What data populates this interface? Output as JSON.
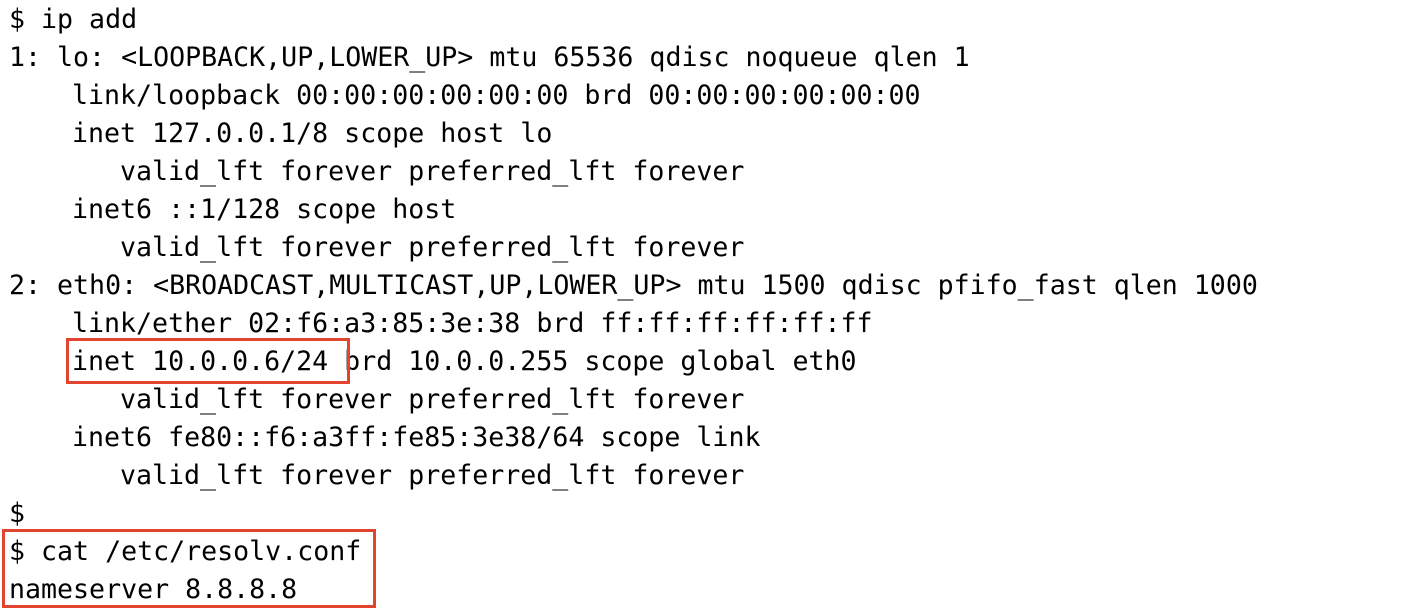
{
  "colors": {
    "background": "#ffffff",
    "text": "#000000",
    "highlight_border": "#e2442f"
  },
  "terminal": {
    "lines": [
      {
        "text": "$ ip add",
        "indent": 0
      },
      {
        "text": "1: lo: <LOOPBACK,UP,LOWER_UP> mtu 65536 qdisc noqueue qlen 1",
        "indent": 0
      },
      {
        "text": "link/loopback 00:00:00:00:00:00 brd 00:00:00:00:00:00",
        "indent": 1
      },
      {
        "text": "inet 127.0.0.1/8 scope host lo",
        "indent": 1
      },
      {
        "text": "valid_lft forever preferred_lft forever",
        "indent": 2
      },
      {
        "text": "inet6 ::1/128 scope host",
        "indent": 1
      },
      {
        "text": "valid_lft forever preferred_lft forever",
        "indent": 2
      },
      {
        "text": "2: eth0: <BROADCAST,MULTICAST,UP,LOWER_UP> mtu 1500 qdisc pfifo_fast qlen 1000",
        "indent": 0
      },
      {
        "text": "link/ether 02:f6:a3:85:3e:38 brd ff:ff:ff:ff:ff:ff",
        "indent": 1
      },
      {
        "text": "inet 10.0.0.6/24 brd 10.0.0.255 scope global eth0",
        "indent": 1
      },
      {
        "text": "valid_lft forever preferred_lft forever",
        "indent": 2
      },
      {
        "text": "inet6 fe80::f6:a3ff:fe85:3e38/64 scope link",
        "indent": 1
      },
      {
        "text": "valid_lft forever preferred_lft forever",
        "indent": 2
      },
      {
        "text": "$",
        "indent": 0
      },
      {
        "text": "$ cat /etc/resolv.conf",
        "indent": 0
      },
      {
        "text": "nameserver 8.8.8.8",
        "indent": 0
      }
    ],
    "highlights": [
      {
        "name": "inet-address-highlight",
        "covers": "inet 10.0.0.6/24"
      },
      {
        "name": "resolv-conf-highlight",
        "covers": "$ cat /etc/resolv.conf / nameserver 8.8.8.8"
      }
    ]
  }
}
